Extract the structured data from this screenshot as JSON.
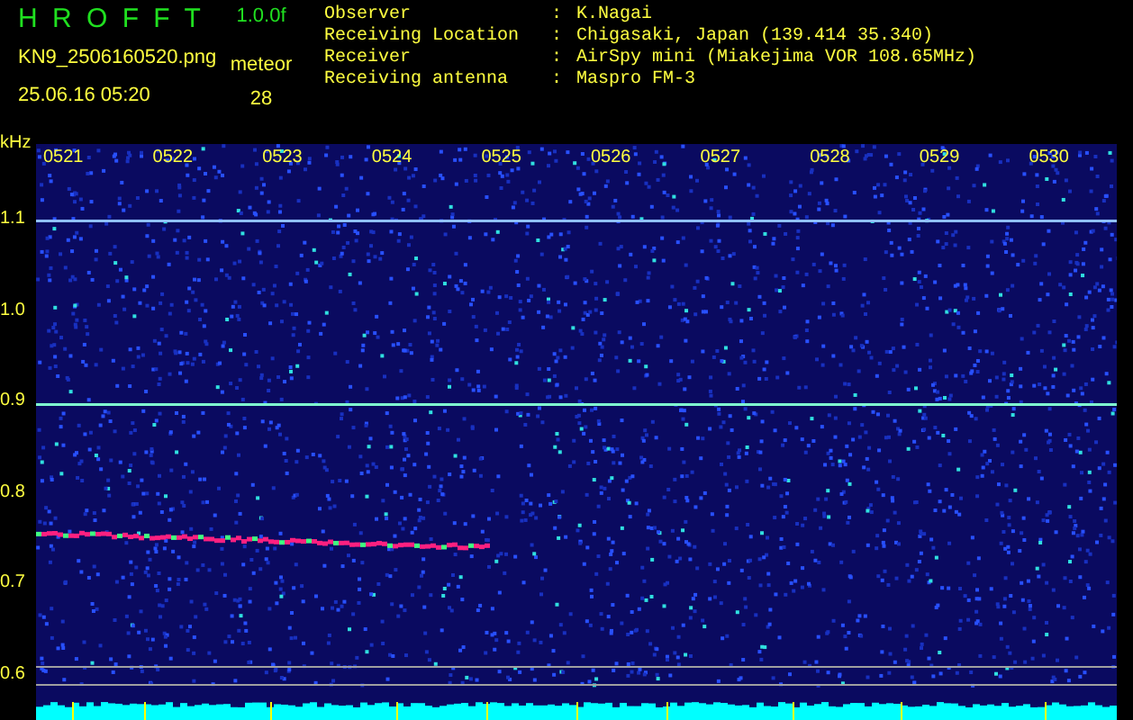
{
  "app": {
    "title": "H R O F F T",
    "version": "1.0.0f",
    "filename": "KN9_2506160520.png",
    "datetime": "25.06.16 05:20",
    "count_label": "meteor",
    "count": "28"
  },
  "info": [
    {
      "label": "Observer",
      "separator": ":",
      "value": "K.Nagai"
    },
    {
      "label": "Receiving Location",
      "separator": ":",
      "value": "Chigasaki, Japan (139.414 35.340)"
    },
    {
      "label": "Receiver",
      "separator": ":",
      "value": "AirSpy mini (Miakejima VOR 108.65MHz)"
    },
    {
      "label": "Receiving antenna",
      "separator": ":",
      "value": "Maspro FM-3"
    }
  ],
  "axis": {
    "y_unit": "kHz",
    "y_labels": [
      "1.1",
      "1.0",
      "0.9",
      "0.8",
      "0.7",
      "0.6"
    ],
    "x_labels": [
      "0521",
      "0522",
      "0523",
      "0524",
      "0525",
      "0526",
      "0527",
      "0528",
      "0529",
      "0530"
    ]
  }
}
